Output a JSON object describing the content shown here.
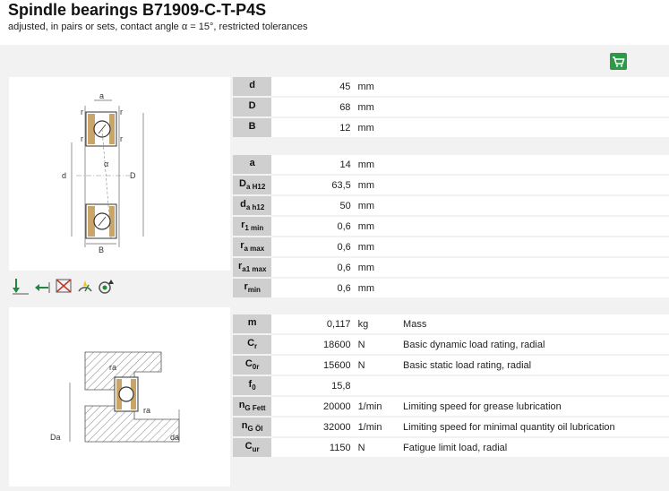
{
  "header": {
    "title": "Spindle bearings B71909-C-T-P4S",
    "subtitle": "adjusted, in pairs or sets, contact angle α = 15°, restricted tolerances"
  },
  "icons": {
    "cart": "shopping-cart-icon",
    "symbols": [
      "radial-load-icon",
      "axial-load-icon",
      "no-separation-icon",
      "speed-icon",
      "grease-icon"
    ]
  },
  "drawing1": {
    "labels": [
      "a",
      "r",
      "r",
      "r",
      "r",
      "d",
      "D",
      "α",
      "B"
    ]
  },
  "drawing2": {
    "labels": [
      "ra",
      "ra",
      "Da",
      "da"
    ]
  },
  "group1": [
    {
      "k": "d",
      "sub": "",
      "v": "45",
      "u": "mm"
    },
    {
      "k": "D",
      "sub": "",
      "v": "68",
      "u": "mm"
    },
    {
      "k": "B",
      "sub": "",
      "v": "12",
      "u": "mm"
    }
  ],
  "group2": [
    {
      "k": "a",
      "sub": "",
      "v": "14",
      "u": "mm"
    },
    {
      "k": "D",
      "sub": "a H12",
      "v": "63,5",
      "u": "mm"
    },
    {
      "k": "d",
      "sub": "a h12",
      "v": "50",
      "u": "mm"
    },
    {
      "k": "r",
      "sub": "1 min",
      "v": "0,6",
      "u": "mm"
    },
    {
      "k": "r",
      "sub": "a max",
      "v": "0,6",
      "u": "mm"
    },
    {
      "k": "r",
      "sub": "a1 max",
      "v": "0,6",
      "u": "mm"
    },
    {
      "k": "r",
      "sub": "min",
      "v": "0,6",
      "u": "mm"
    }
  ],
  "group3": [
    {
      "k": "m",
      "sub": "",
      "v": "0,117",
      "u": "kg",
      "d": "Mass"
    },
    {
      "k": "C",
      "sub": "r",
      "v": "18600",
      "u": "N",
      "d": "Basic dynamic load rating, radial"
    },
    {
      "k": "C",
      "sub": "0r",
      "v": "15600",
      "u": "N",
      "d": "Basic static load rating, radial"
    },
    {
      "k": "f",
      "sub": "0",
      "v": "15,8",
      "u": "",
      "d": ""
    },
    {
      "k": "n",
      "sub": "G Fett",
      "v": "20000",
      "u": "1/min",
      "d": "Limiting speed for grease lubrication"
    },
    {
      "k": "n",
      "sub": "G Öl",
      "v": "32000",
      "u": "1/min",
      "d": "Limiting speed for minimal quantity oil lubrication"
    },
    {
      "k": "C",
      "sub": "ur",
      "v": "1150",
      "u": "N",
      "d": "Fatigue limit load, radial"
    }
  ]
}
